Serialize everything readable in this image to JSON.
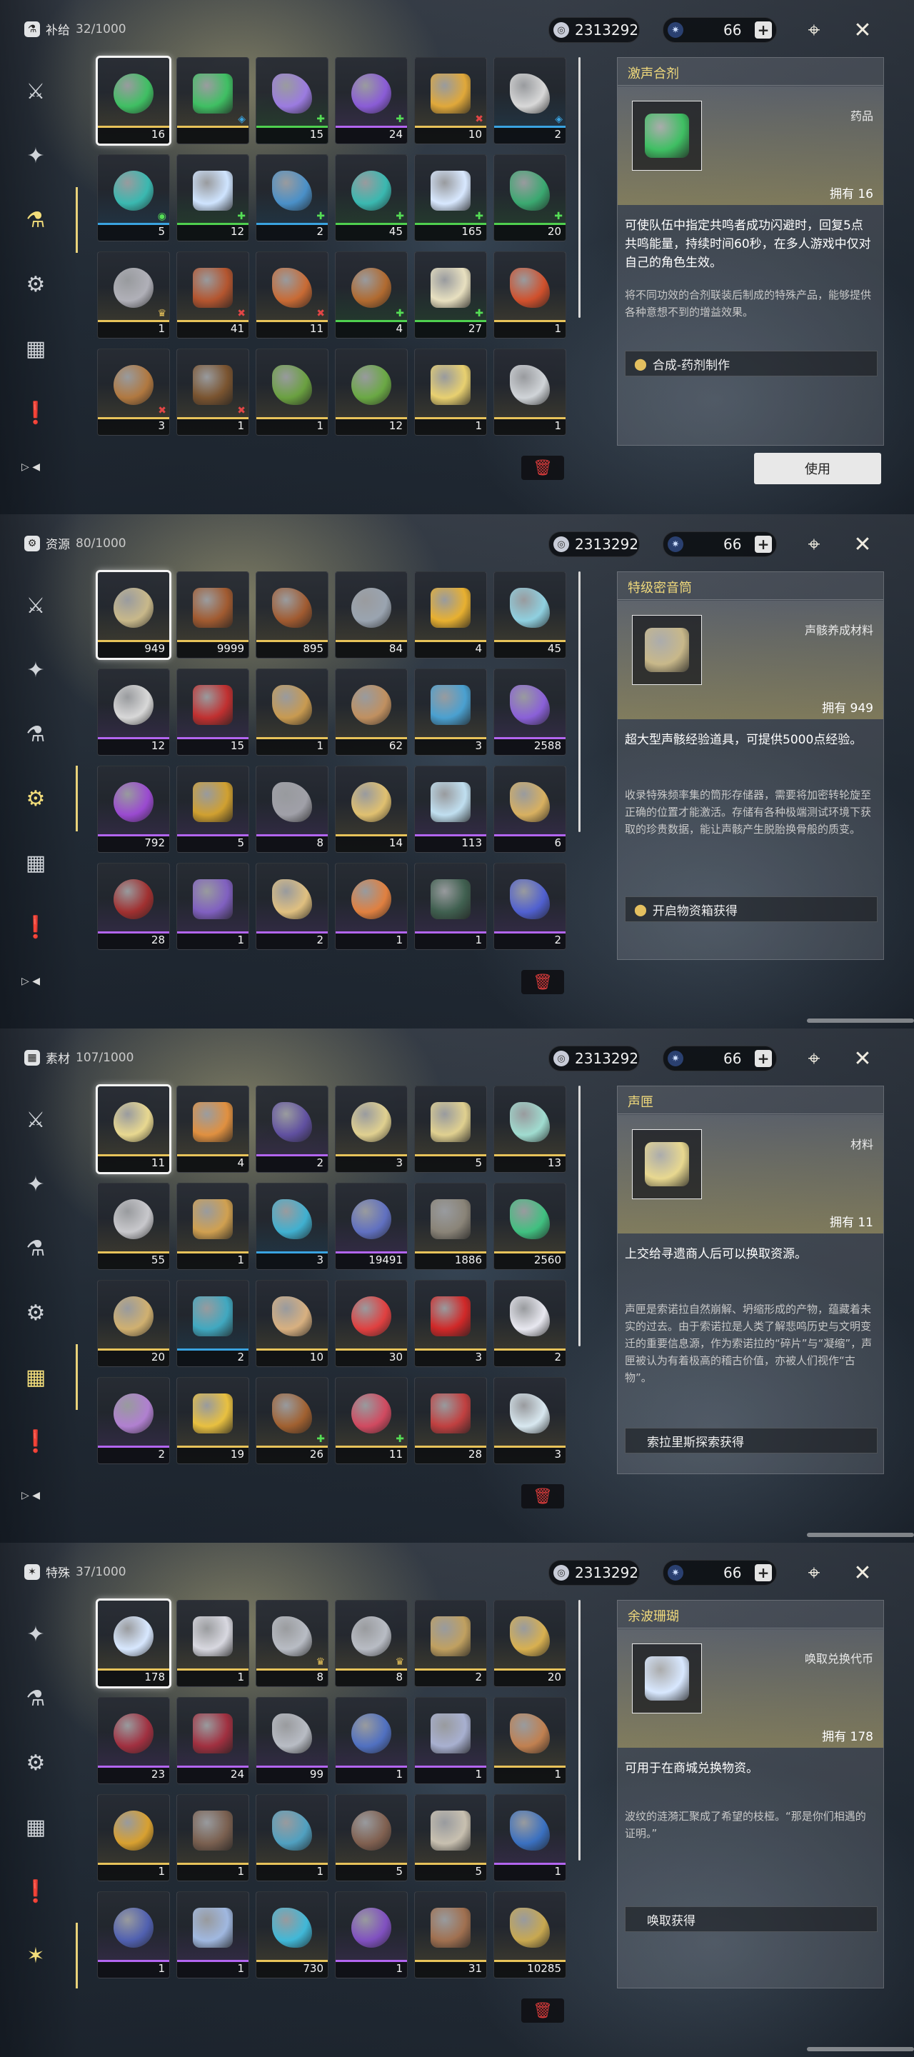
{
  "currency": {
    "union": "2313292",
    "astrite": "66",
    "plus_label": "+"
  },
  "colors": {
    "green": "#4fd04f",
    "blue": "#3aa3e0",
    "purple": "#b365f0",
    "gold": "#e8c35a",
    "red": "#e24646"
  },
  "panels": [
    {
      "category": "补给",
      "count": "32/1000",
      "cat_icon": "flask",
      "items": [
        {
          "count": "16",
          "rarity": "gold",
          "color": "#3fbf63",
          "badge": "",
          "sel": true
        },
        {
          "count": "",
          "rarity": "gold",
          "color": "#3fbf63",
          "badge": "◈"
        },
        {
          "count": "15",
          "rarity": "green",
          "color": "#9b7be0",
          "badge": "✚"
        },
        {
          "count": "24",
          "rarity": "purple",
          "color": "#8a5cd6",
          "badge": "✚"
        },
        {
          "count": "10",
          "rarity": "gold",
          "color": "#e0a83a",
          "badge": "✖"
        },
        {
          "count": "2",
          "rarity": "blue",
          "color": "#d8d8d8",
          "badge": "◈"
        },
        {
          "count": "5",
          "rarity": "blue",
          "color": "#3ab8b0",
          "badge": "◉"
        },
        {
          "count": "12",
          "rarity": "green",
          "color": "#cfe4ff",
          "badge": "✚"
        },
        {
          "count": "2",
          "rarity": "blue",
          "color": "#4a90c8",
          "badge": "✚"
        },
        {
          "count": "45",
          "rarity": "green",
          "color": "#3ab8b0",
          "badge": "✚"
        },
        {
          "count": "165",
          "rarity": "green",
          "color": "#d8e8ff",
          "badge": "✚"
        },
        {
          "count": "20",
          "rarity": "green",
          "color": "#3aa870",
          "badge": "✚"
        },
        {
          "count": "1",
          "rarity": "gold",
          "color": "#b0b0b8",
          "badge": "♛"
        },
        {
          "count": "41",
          "rarity": "gold",
          "color": "#b3552f",
          "badge": "✖"
        },
        {
          "count": "11",
          "rarity": "gold",
          "color": "#c86a34",
          "badge": "✖"
        },
        {
          "count": "4",
          "rarity": "green",
          "color": "#b06a30",
          "badge": "✚"
        },
        {
          "count": "27",
          "rarity": "green",
          "color": "#e8e0c0",
          "badge": "✚"
        },
        {
          "count": "1",
          "rarity": "gold",
          "color": "#d0502c",
          "badge": ""
        },
        {
          "count": "3",
          "rarity": "gold",
          "color": "#b07840",
          "badge": "✖"
        },
        {
          "count": "1",
          "rarity": "gold",
          "color": "#7a5430",
          "badge": "✖"
        },
        {
          "count": "1",
          "rarity": "gold",
          "color": "#6aa040",
          "badge": ""
        },
        {
          "count": "12",
          "rarity": "gold",
          "color": "#6aa844",
          "badge": ""
        },
        {
          "count": "1",
          "rarity": "gold",
          "color": "#e8d070",
          "badge": ""
        },
        {
          "count": "1",
          "rarity": "gold",
          "color": "#d0d4d8",
          "badge": ""
        }
      ],
      "detail": {
        "name": "激声合剂",
        "type": "药品",
        "owned": "拥有 16",
        "thumb_color": "#3fbf63",
        "desc1": "可使队伍中指定共鸣者成功闪避时，回复5点共鸣能量，持续时间60秒，在多人游戏中仅对自己的角色生效。",
        "desc2": "将不同功效的合剂联装后制成的特殊产品，能够提供各种意想不到的增益效果。",
        "source": "合成-药剂制作",
        "use_label": "使用",
        "show_pin": true
      }
    },
    {
      "category": "资源",
      "count": "80/1000",
      "cat_icon": "gear",
      "items": [
        {
          "count": "949",
          "rarity": "gold",
          "color": "#c8b88a",
          "badge": "",
          "sel": true
        },
        {
          "count": "9999",
          "rarity": "gold",
          "color": "#a05a30",
          "badge": ""
        },
        {
          "count": "895",
          "rarity": "gold",
          "color": "#a05a30",
          "badge": ""
        },
        {
          "count": "84",
          "rarity": "gold",
          "color": "#9aa4b0",
          "badge": ""
        },
        {
          "count": "4",
          "rarity": "gold",
          "color": "#e8b030",
          "badge": ""
        },
        {
          "count": "45",
          "rarity": "gold",
          "color": "#8fd0e0",
          "badge": ""
        },
        {
          "count": "12",
          "rarity": "purple",
          "color": "#d8d8d8",
          "badge": ""
        },
        {
          "count": "15",
          "rarity": "purple",
          "color": "#c03030",
          "badge": ""
        },
        {
          "count": "1",
          "rarity": "gold",
          "color": "#c89a50",
          "badge": ""
        },
        {
          "count": "62",
          "rarity": "gold",
          "color": "#c09060",
          "badge": ""
        },
        {
          "count": "3",
          "rarity": "gold",
          "color": "#4aa0d0",
          "badge": ""
        },
        {
          "count": "2588",
          "rarity": "purple",
          "color": "#8a60d8",
          "badge": ""
        },
        {
          "count": "792",
          "rarity": "purple",
          "color": "#9a4ad0",
          "badge": ""
        },
        {
          "count": "5",
          "rarity": "purple",
          "color": "#d0a030",
          "badge": ""
        },
        {
          "count": "8",
          "rarity": "purple",
          "color": "#a0a0a8",
          "badge": ""
        },
        {
          "count": "14",
          "rarity": "gold",
          "color": "#e0c070",
          "badge": ""
        },
        {
          "count": "113",
          "rarity": "purple",
          "color": "#c0dff0",
          "badge": ""
        },
        {
          "count": "6",
          "rarity": "purple",
          "color": "#d8b060",
          "badge": ""
        },
        {
          "count": "28",
          "rarity": "purple",
          "color": "#a03030",
          "badge": ""
        },
        {
          "count": "1",
          "rarity": "purple",
          "color": "#8060c0",
          "badge": ""
        },
        {
          "count": "2",
          "rarity": "purple",
          "color": "#e0c080",
          "badge": ""
        },
        {
          "count": "1",
          "rarity": "purple",
          "color": "#e08040",
          "badge": ""
        },
        {
          "count": "1",
          "rarity": "purple",
          "color": "#406050",
          "badge": ""
        },
        {
          "count": "2",
          "rarity": "purple",
          "color": "#5060d0",
          "badge": ""
        }
      ],
      "detail": {
        "name": "特级密音筒",
        "type": "声骸养成材料",
        "owned": "拥有 949",
        "thumb_color": "#c8b88a",
        "desc1": "超大型声骸经验道具，可提供5000点经验。",
        "desc2": "收录特殊频率集的筒形存储器，需要将加密转轮旋至正确的位置才能激活。存储有各种极端测试环境下获取的珍贵数据，能让声骸产生脱胎换骨般的质变。",
        "source": "开启物资箱获得",
        "use_label": "",
        "show_pin": true
      }
    },
    {
      "category": "素材",
      "count": "107/1000",
      "cat_icon": "box",
      "items": [
        {
          "count": "11",
          "rarity": "gold",
          "color": "#e8d890",
          "badge": "",
          "sel": true
        },
        {
          "count": "4",
          "rarity": "gold",
          "color": "#e09040",
          "badge": ""
        },
        {
          "count": "2",
          "rarity": "purple",
          "color": "#6050a0",
          "badge": ""
        },
        {
          "count": "3",
          "rarity": "gold",
          "color": "#e0d090",
          "badge": ""
        },
        {
          "count": "5",
          "rarity": "gold",
          "color": "#e0d090",
          "badge": ""
        },
        {
          "count": "13",
          "rarity": "gold",
          "color": "#a0dcd0",
          "badge": ""
        },
        {
          "count": "55",
          "rarity": "gold",
          "color": "#c8c8cc",
          "badge": ""
        },
        {
          "count": "1",
          "rarity": "gold",
          "color": "#d0a050",
          "badge": ""
        },
        {
          "count": "3",
          "rarity": "blue",
          "color": "#40b0d0",
          "badge": ""
        },
        {
          "count": "19491",
          "rarity": "purple",
          "color": "#6070c0",
          "badge": ""
        },
        {
          "count": "1886",
          "rarity": "gold",
          "color": "#8a8478",
          "badge": ""
        },
        {
          "count": "2560",
          "rarity": "gold",
          "color": "#40c080",
          "badge": ""
        },
        {
          "count": "20",
          "rarity": "gold",
          "color": "#d0b070",
          "badge": ""
        },
        {
          "count": "2",
          "rarity": "blue",
          "color": "#40a8c0",
          "badge": ""
        },
        {
          "count": "10",
          "rarity": "gold",
          "color": "#d8b080",
          "badge": ""
        },
        {
          "count": "30",
          "rarity": "gold",
          "color": "#e04040",
          "badge": ""
        },
        {
          "count": "3",
          "rarity": "gold",
          "color": "#d02828",
          "badge": ""
        },
        {
          "count": "2",
          "rarity": "gold",
          "color": "#e8e8f0",
          "badge": ""
        },
        {
          "count": "2",
          "rarity": "purple",
          "color": "#b080d0",
          "badge": ""
        },
        {
          "count": "19",
          "rarity": "gold",
          "color": "#e8c040",
          "badge": ""
        },
        {
          "count": "26",
          "rarity": "gold",
          "color": "#a06030",
          "badge": "✚"
        },
        {
          "count": "11",
          "rarity": "gold",
          "color": "#d04a60",
          "badge": "✚"
        },
        {
          "count": "28",
          "rarity": "gold",
          "color": "#c04040",
          "badge": ""
        },
        {
          "count": "3",
          "rarity": "gold",
          "color": "#d8e8f0",
          "badge": ""
        }
      ],
      "detail": {
        "name": "声匣",
        "type": "材料",
        "owned": "拥有 11",
        "thumb_color": "#e8d890",
        "desc1": "上交给寻遗商人后可以换取资源。",
        "desc2": "声匣是索诺拉自然崩解、坍缩形成的产物，蕴藏着未实的过去。由于索诺拉是人类了解悲鸣历史与文明变迁的重要信息源，作为索诺拉的“碎片”与“凝缩”，声匣被认为有着极高的稽古价值，亦被人们视作“古物”。",
        "source": "索拉里斯探索获得",
        "use_label": "",
        "show_pin": false
      }
    },
    {
      "category": "特殊",
      "count": "37/1000",
      "cat_icon": "star",
      "items": [
        {
          "count": "178",
          "rarity": "gold",
          "color": "#d8e8ff",
          "badge": "",
          "sel": true
        },
        {
          "count": "1",
          "rarity": "gold",
          "color": "#d8d8e0",
          "badge": ""
        },
        {
          "count": "8",
          "rarity": "gold",
          "color": "#b8bcc4",
          "badge": "♛"
        },
        {
          "count": "8",
          "rarity": "gold",
          "color": "#b8bcc4",
          "badge": "♛"
        },
        {
          "count": "2",
          "rarity": "gold",
          "color": "#c0a060",
          "badge": ""
        },
        {
          "count": "20",
          "rarity": "gold",
          "color": "#d8b050",
          "badge": ""
        },
        {
          "count": "23",
          "rarity": "purple",
          "color": "#a03040",
          "badge": ""
        },
        {
          "count": "24",
          "rarity": "purple",
          "color": "#a03040",
          "badge": ""
        },
        {
          "count": "99",
          "rarity": "purple",
          "color": "#b8bcc4",
          "badge": ""
        },
        {
          "count": "1",
          "rarity": "purple",
          "color": "#5070c0",
          "badge": ""
        },
        {
          "count": "1",
          "rarity": "purple",
          "color": "#a8b0d0",
          "badge": ""
        },
        {
          "count": "1",
          "rarity": "gold",
          "color": "#c08050",
          "badge": ""
        },
        {
          "count": "1",
          "rarity": "gold",
          "color": "#d8a030",
          "badge": ""
        },
        {
          "count": "1",
          "rarity": "gold",
          "color": "#7a6050",
          "badge": ""
        },
        {
          "count": "1",
          "rarity": "gold",
          "color": "#50a0c0",
          "badge": ""
        },
        {
          "count": "5",
          "rarity": "gold",
          "color": "#806050",
          "badge": ""
        },
        {
          "count": "5",
          "rarity": "gold",
          "color": "#c8c0b0",
          "badge": ""
        },
        {
          "count": "1",
          "rarity": "purple",
          "color": "#3a70c0",
          "badge": ""
        },
        {
          "count": "1",
          "rarity": "purple",
          "color": "#5060b0",
          "badge": ""
        },
        {
          "count": "1",
          "rarity": "purple",
          "color": "#a0b8e0",
          "badge": ""
        },
        {
          "count": "730",
          "rarity": "gold",
          "color": "#40b8d8",
          "badge": ""
        },
        {
          "count": "1",
          "rarity": "purple",
          "color": "#8050c0",
          "badge": ""
        },
        {
          "count": "31",
          "rarity": "gold",
          "color": "#a07050",
          "badge": ""
        },
        {
          "count": "10285",
          "rarity": "gold",
          "color": "#c8a850",
          "badge": ""
        }
      ],
      "detail": {
        "name": "余波珊瑚",
        "type": "唤取兑换代币",
        "owned": "拥有 178",
        "thumb_color": "#d8e8ff",
        "desc1": "可用于在商城兑换物资。",
        "desc2": "波纹的涟漪汇聚成了希望的枝桠。“那是你们相遇的证明。”",
        "source": "唤取获得",
        "use_label": "",
        "show_pin": false
      }
    }
  ]
}
